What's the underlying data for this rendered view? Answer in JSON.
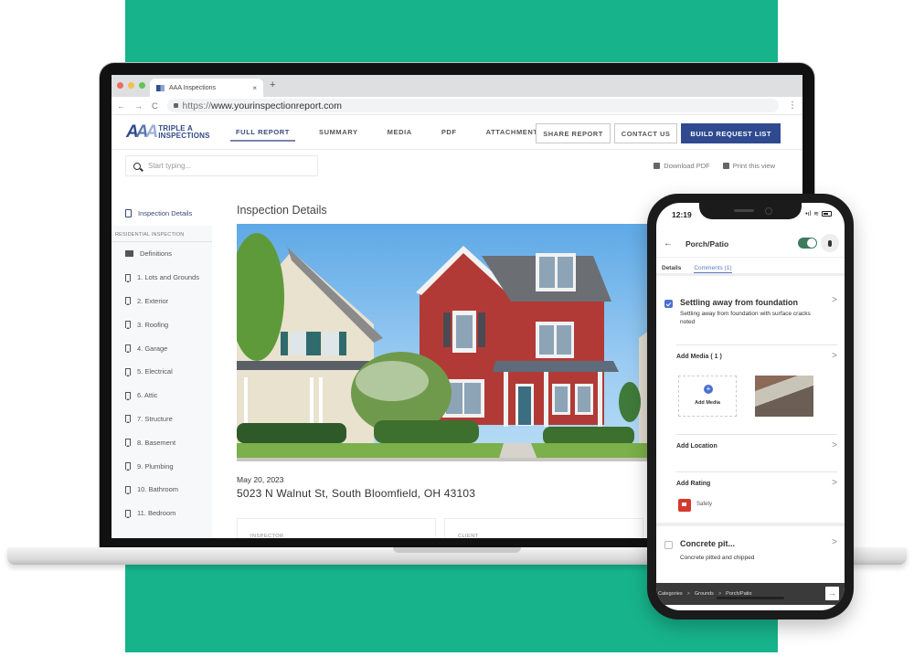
{
  "colors": {
    "background_accent": "#17b48c",
    "brand_primary": "#2f4a8f",
    "toggle_on": "#3d7a5e",
    "checkbox_checked": "#4a72d0",
    "safety_flag": "#d43a2c"
  },
  "browser": {
    "tab_title": "AAA Inspections",
    "tab_close": "×",
    "new_tab": "+",
    "back": "←",
    "forward": "→",
    "reload": "C",
    "url_protocol": "https://",
    "url_host": "www.yourinspectionreport.com",
    "menu": "⋮"
  },
  "header": {
    "logo_mark": [
      "A",
      "A",
      "A"
    ],
    "logo_text_line1": "TRIPLE A",
    "logo_text_line2": "INSPECTIONS",
    "nav": [
      {
        "label": "FULL REPORT",
        "active": true
      },
      {
        "label": "SUMMARY",
        "active": false
      },
      {
        "label": "MEDIA",
        "active": false
      },
      {
        "label": "PDF",
        "active": false
      },
      {
        "label": "ATTACHMENTS",
        "active": false
      }
    ],
    "buttons": {
      "share": "SHARE REPORT",
      "contact": "CONTACT US",
      "build": "BUILD REQUEST LIST"
    }
  },
  "subbar": {
    "search_placeholder": "Start typing...",
    "download_pdf": "Download PDF",
    "print_view": "Print this view"
  },
  "sidebar": {
    "top_item": "Inspection Details",
    "section_label": "RESIDENTIAL INSPECTION",
    "definitions": "Definitions",
    "items": [
      "1. Lots and Grounds",
      "2. Exterior",
      "3. Roofing",
      "4. Garage",
      "5. Electrical",
      "6. Attic",
      "7. Structure",
      "8. Basement",
      "9. Plumbing",
      "10. Bathroom",
      "11. Bedroom"
    ]
  },
  "main": {
    "title": "Inspection Details",
    "date": "May 20, 2023",
    "address": "5023 N Walnut St, South Bloomfield, OH 43103",
    "cards": [
      "INSPECTOR",
      "CLIENT"
    ]
  },
  "phone": {
    "time": "12:19",
    "signal": "•ıl",
    "wifi": "≋",
    "title": "Porch/Patio",
    "toggle_on": true,
    "tabs": [
      {
        "label": "Details",
        "active": false
      },
      {
        "label": "Comments (1)",
        "active": true
      }
    ],
    "comments": [
      {
        "title": "Settling away from foundation",
        "description": "Settling away from foundation with surface cracks noted",
        "checked": true
      },
      {
        "title": "Concrete pit...",
        "description": "Concrete pitted and chipped",
        "checked": false
      }
    ],
    "add_media_title": "Add Media ( 1 )",
    "add_media_button": "Add Media",
    "add_location": "Add Location",
    "add_rating": "Add Rating",
    "rating_value": "Safety",
    "breadcrumb": [
      "Categories",
      "Grounds",
      "Porch/Patio"
    ],
    "chevron": ">",
    "go": "→"
  }
}
